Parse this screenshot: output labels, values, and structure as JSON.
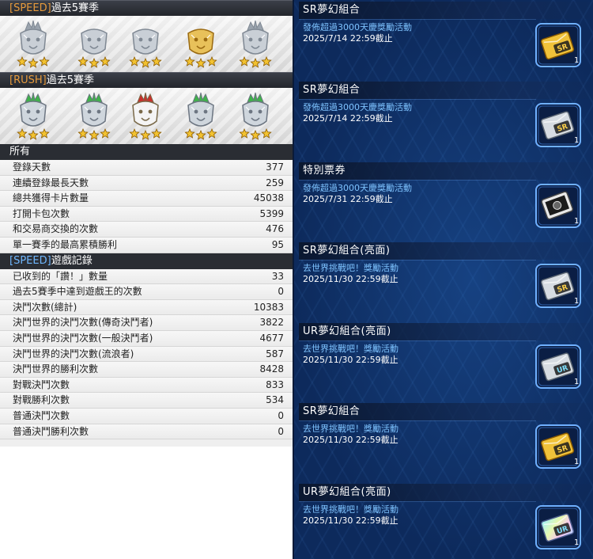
{
  "left": {
    "speed_header": {
      "tag": "[SPEED]",
      "text": "過去5賽季"
    },
    "speed_medals": [
      {
        "icon": "silver-crowned-dragon-medal-icon",
        "stars": 3
      },
      {
        "icon": "silver-dragon-medal-icon",
        "stars": 3
      },
      {
        "icon": "silver-dragon-medal-icon",
        "stars": 3
      },
      {
        "icon": "gold-lion-medal-icon",
        "stars": 3
      },
      {
        "icon": "silver-crowned-dragon-medal-icon",
        "stars": 3
      }
    ],
    "rush_header": {
      "tag": "[RUSH]",
      "text": "過去5賽季"
    },
    "rush_medals": [
      {
        "icon": "green-crowned-eagle-medal-icon",
        "stars": 3
      },
      {
        "icon": "green-crowned-eagle-medal-icon",
        "stars": 3
      },
      {
        "icon": "red-crowned-eagle-medal-icon",
        "stars": 3
      },
      {
        "icon": "green-crowned-eagle-medal-icon",
        "stars": 3
      },
      {
        "icon": "green-crowned-eagle-medal-icon",
        "stars": 3
      }
    ],
    "all_header": "所有",
    "all_stats": [
      {
        "label": "登錄天數",
        "value": "377"
      },
      {
        "label": "連續登錄最長天數",
        "value": "259"
      },
      {
        "label": "總共獲得卡片數量",
        "value": "45038"
      },
      {
        "label": "打開卡包次數",
        "value": "5399"
      },
      {
        "label": "和交易商交換的次數",
        "value": "476"
      },
      {
        "label": "單一賽季的最高累積勝利",
        "value": "95"
      }
    ],
    "speed_record_header": {
      "tag": "[SPEED]",
      "text": "遊戲記錄"
    },
    "speed_stats": [
      {
        "label": "已收到的「讚！」數量",
        "value": "33"
      },
      {
        "label": "過去5賽季中達到遊戲王的次數",
        "value": "0"
      },
      {
        "label": "決鬥次數(總計)",
        "value": "10383"
      },
      {
        "label": "決鬥世界的決鬥次數(傳奇決鬥者)",
        "value": "3822"
      },
      {
        "label": "決鬥世界的決鬥次數(一般決鬥者)",
        "value": "4677"
      },
      {
        "label": "決鬥世界的決鬥次數(流浪者)",
        "value": "587"
      },
      {
        "label": "決鬥世界的勝利次數",
        "value": "8428"
      },
      {
        "label": "對戰決鬥次數",
        "value": "833"
      },
      {
        "label": "對戰勝利次數",
        "value": "534"
      },
      {
        "label": "普通決鬥次數",
        "value": "0"
      },
      {
        "label": "普通決鬥勝利次數",
        "value": "0"
      }
    ]
  },
  "gifts": [
    {
      "title": "SR夢幻組合",
      "desc": "發佈超過3000天慶獎勵活動",
      "date": "2025/7/14 22:59截止",
      "item": {
        "rarity": "SR",
        "count": "1",
        "icon": "gold-sr-card-pack-icon"
      }
    },
    {
      "title": "SR夢幻組合",
      "desc": "發佈超過3000天慶獎勵活動",
      "date": "2025/7/14 22:59截止",
      "item": {
        "rarity": "SR",
        "count": "1",
        "icon": "silver-sr-card-pack-icon"
      }
    },
    {
      "title": "特別票券",
      "desc": "發佈超過3000天慶獎勵活動",
      "date": "2025/7/31 22:59截止",
      "item": {
        "rarity": "",
        "count": "1",
        "icon": "special-ticket-icon"
      }
    },
    {
      "title": "SR夢幻組合(亮面)",
      "desc": "去世界挑戰吧！獎勵活動",
      "date": "2025/11/30 22:59截止",
      "item": {
        "rarity": "SR",
        "count": "1",
        "icon": "silver-sr-card-pack-icon"
      }
    },
    {
      "title": "UR夢幻組合(亮面)",
      "desc": "去世界挑戰吧！獎勵活動",
      "date": "2025/11/30 22:59截止",
      "item": {
        "rarity": "UR",
        "count": "1",
        "icon": "silver-ur-card-pack-icon"
      }
    },
    {
      "title": "SR夢幻組合",
      "desc": "去世界挑戰吧！獎勵活動",
      "date": "2025/11/30 22:59截止",
      "item": {
        "rarity": "SR",
        "count": "1",
        "icon": "gold-sr-card-pack-icon"
      }
    },
    {
      "title": "UR夢幻組合(亮面)",
      "desc": "去世界挑戰吧！獎勵活動",
      "date": "2025/11/30 22:59截止",
      "item": {
        "rarity": "UR",
        "count": "1",
        "icon": "rainbow-ur-card-pack-icon"
      }
    }
  ]
}
